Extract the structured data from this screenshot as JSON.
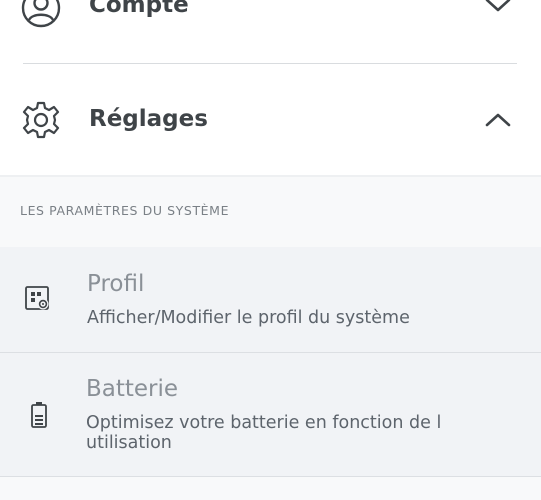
{
  "menu": {
    "account": {
      "label": "Compte",
      "icon": "user-circle-icon",
      "state": "collapsed"
    },
    "settings": {
      "label": "Réglages",
      "icon": "gear-icon",
      "state": "expanded"
    }
  },
  "settings_panel": {
    "section_title": "LES PARAMÈTRES DU SYSTÈME",
    "items": [
      {
        "title": "Profil",
        "description": "Afficher/Modifier le profil du système",
        "icon": "profile-settings-icon"
      },
      {
        "title": "Batterie",
        "description": "Optimisez votre batterie en fonction de l utilisation",
        "icon": "battery-icon"
      }
    ]
  },
  "colors": {
    "text_primary": "#3f4448",
    "text_muted": "#8a9097",
    "item_bg": "#f1f3f6",
    "section_bg": "#f8f9fa"
  }
}
